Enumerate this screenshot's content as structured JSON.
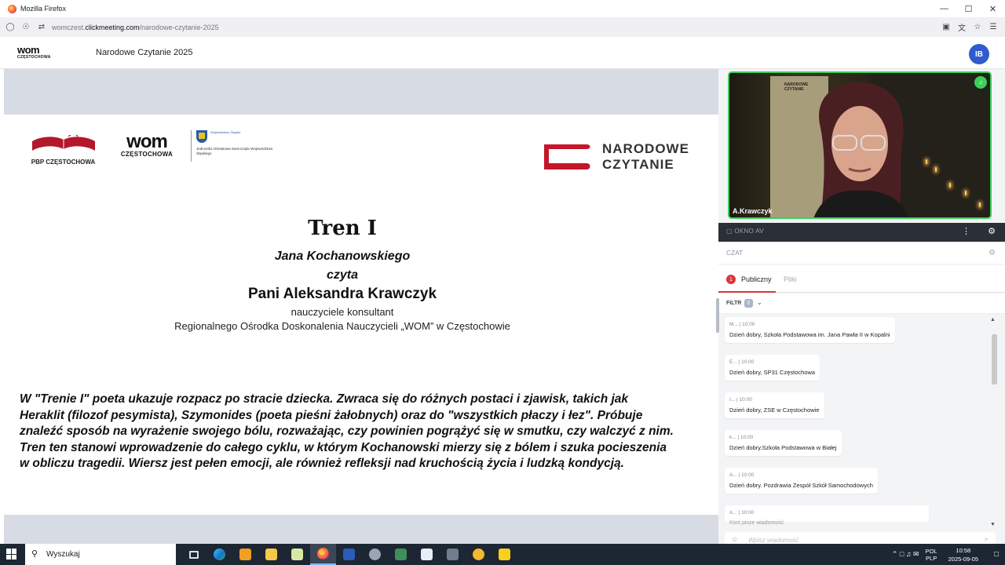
{
  "browser": {
    "window_title": "Mozilla Firefox",
    "url_prefix": "womczest.",
    "url_domain": "clickmeeting.com",
    "url_path": "/narodowe-czytanie-2025",
    "icons": [
      "shield-icon",
      "lock-icon",
      "permissions-icon",
      "page-icon",
      "translate-icon",
      "star-icon",
      "menu-icon"
    ]
  },
  "app": {
    "logo_top": "wom",
    "logo_bottom": "CZĘSTOCHOWA",
    "title": "Narodowe Czytanie 2025",
    "avatar_initials": "IB",
    "avatar_color": "#2f5bcf"
  },
  "slide": {
    "logo_pbp": "PBP CZĘSTOCHOWA",
    "logo_wom_top": "wom",
    "logo_wom_bottom": "CZĘSTOCHOWA",
    "logo_slaskie_top": "Województwo Śląskie",
    "logo_slaskie_bottom": "Jednostka Oświatowa Samorządu Województwa Śląskiego",
    "logo_nc_line1": "NARODOWE",
    "logo_nc_line2": "CZYTANIE",
    "title": "Tren I",
    "author": "Jana Kochanowskiego",
    "reads": "czyta",
    "reader": "Pani Aleksandra Krawczyk",
    "role": "nauczyciele konsultant",
    "institution": "Regionalnego Ośrodka Doskonalenia Nauczycieli „WOM” w Częstochowie",
    "description_lines": [
      "W \"Trenie I\" poeta ukazuje rozpacz po stracie dziecka. Zwraca się do różnych postaci i zjawisk, takich jak",
      "Heraklit (filozof pesymista), Szymonides (poeta pieśni żałobnych) oraz do \"wszystkich płaczy i łez\". Próbuje",
      "znaleźć sposób na wyrażenie swojego bólu, rozważając, czy powinien pogrążyć się w smutku, czy walczyć z nim.",
      "Tren ten stanowi wprowadzenie do całego cyklu, w którym Kochanowski mierzy się z bólem i szuka pocieszenia",
      "w obliczu tragedii. Wiersz jest pełen emocji, ale również refleksji nad kruchością życia i ludzką kondycją."
    ]
  },
  "video": {
    "participant": "A.Krawczyk",
    "poster_label_1": "NARODOWE",
    "poster_label_2": "CZYTANIE",
    "speaking_color": "#3ccf5a",
    "av_window_label": "OKNO AV"
  },
  "chat": {
    "header": "CZAT",
    "tab_public": "Publiczny",
    "tab_public_badge": "1",
    "tab_files": "Pliki",
    "filter_label": "FILTR",
    "filter_count": "0",
    "messages": [
      {
        "author": "M...",
        "time": "10:00",
        "text": "Dzień dobry, Szkoła Podstawowa im. Jana Pawła II w Kopalni"
      },
      {
        "author": "E...",
        "time": "10:00",
        "text": "Dzień dobry, SP31 Częstochowa"
      },
      {
        "author": "I...",
        "time": "10:00",
        "text": "Dzień dobry, ZSE w Częstochowie"
      },
      {
        "author": "k...",
        "time": "10:00",
        "text": "Dzień dobry.Szkoła Podstawowa w Białej"
      },
      {
        "author": "A...",
        "time": "10:00",
        "text": "Dzień dobry. Pozdrawia Zespół Szkół Samochodowych"
      },
      {
        "author": "A...",
        "time": "10:00",
        "text": ""
      }
    ],
    "typing": "Ktoś pisze wiadomość",
    "input_placeholder": "Wpisz wiadomość",
    "accent_color": "#d9363e"
  },
  "taskbar": {
    "search_placeholder": "Wyszukaj",
    "lang_line1": "POL",
    "lang_line2": "PLP",
    "time": "10:58",
    "date": "2025-09-05",
    "apps": [
      "task-view-icon",
      "edge-icon",
      "media-icon",
      "file-explorer-icon",
      "notepad-icon",
      "firefox-icon",
      "word-icon",
      "app-icon",
      "app2-icon",
      "store-icon",
      "calculator-icon",
      "weather-icon",
      "sticky-notes-icon"
    ]
  }
}
